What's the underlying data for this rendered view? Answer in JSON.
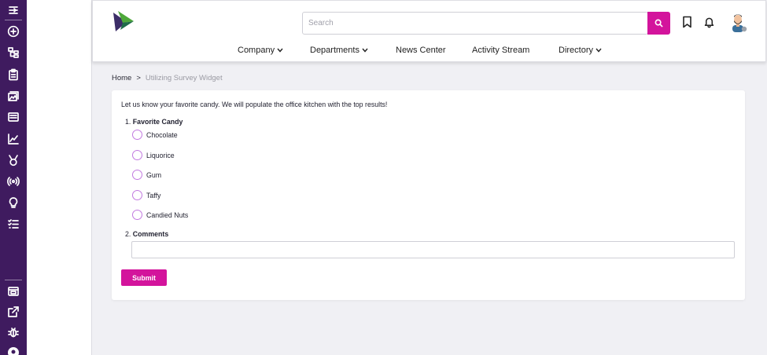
{
  "sidebar": {
    "top_icons": [
      "menu-icon",
      "plus-circle-icon",
      "hierarchy-icon",
      "clipboard-icon",
      "images-icon",
      "news-icon",
      "chart-line-icon",
      "medal-icon",
      "broadcast-icon",
      "lightbulb-icon",
      "checklist-icon"
    ],
    "bottom_icons": [
      "browser-window-icon",
      "external-link-icon",
      "bug-icon",
      "user-avatar-icon"
    ]
  },
  "header": {
    "search": {
      "placeholder": "Search",
      "value": ""
    },
    "icons": [
      "search-icon",
      "bookmark-icon",
      "bell-icon",
      "user-avatar"
    ],
    "nav": [
      {
        "label": "Company",
        "dropdown": true
      },
      {
        "label": "Departments",
        "dropdown": true
      },
      {
        "label": "News Center",
        "dropdown": false
      },
      {
        "label": "Activity Stream",
        "dropdown": false
      },
      {
        "label": "Directory",
        "dropdown": true
      }
    ]
  },
  "breadcrumb": {
    "home": "Home",
    "separator": ">",
    "current": "Utilizing Survey Widget"
  },
  "survey": {
    "intro": "Let us know your favorite candy. We will populate the office kitchen with the top results!",
    "q1": {
      "number": "1.",
      "title": "Favorite Candy",
      "options": [
        "Chocolate",
        "Liquorice",
        "Gum",
        "Taffy",
        "Candied Nuts"
      ]
    },
    "q2": {
      "number": "2.",
      "title": "Comments",
      "value": ""
    },
    "submit_label": "Submit"
  },
  "colors": {
    "sidebar": "#3f1b5f",
    "accent": "#d3149c",
    "radio_border": "#c27ae0",
    "background": "#f0f0f4"
  }
}
